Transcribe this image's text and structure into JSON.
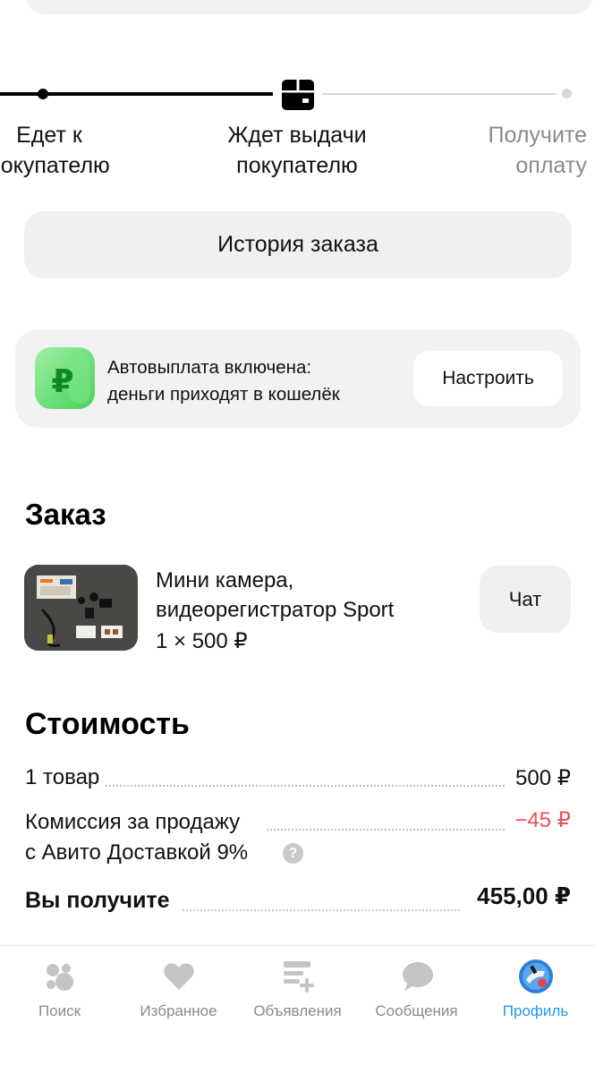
{
  "progress": {
    "steps": [
      {
        "label": "Едет к\nпокупателю",
        "state": "done"
      },
      {
        "label": "Ждет выдачи\nпокупателю",
        "state": "current"
      },
      {
        "label": "Получите\nоплату",
        "state": "todo"
      }
    ],
    "current_icon": "package-icon"
  },
  "history_button": "История заказа",
  "payout": {
    "icon": "ruble-wallet-icon",
    "text": "Автовыплата включена:\nденьги приходят в кошелёк",
    "button": "Настроить"
  },
  "order": {
    "title": "Заказ",
    "item_title": "Мини камера,\nвидеорегистратор Sport",
    "item_price": "1 × 500 ₽",
    "chat_button": "Чат"
  },
  "cost": {
    "title": "Стоимость",
    "rows": [
      {
        "label": "1 товар",
        "value": "500 ₽"
      },
      {
        "label": "Комиссия за продажу\nс Авито Доставкой 9%",
        "value": "−45 ₽"
      },
      {
        "label": "Вы получите",
        "value": "455,00 ₽"
      }
    ],
    "help_icon_label": "?"
  },
  "tabbar": {
    "tabs": [
      {
        "label": "Поиск",
        "icon": "search-dots-icon"
      },
      {
        "label": "Избранное",
        "icon": "heart-icon"
      },
      {
        "label": "Объявления",
        "icon": "listing-add-icon"
      },
      {
        "label": "Сообщения",
        "icon": "chat-bubble-icon"
      },
      {
        "label": "Профиль",
        "icon": "profile-avatar-icon",
        "active": true
      }
    ]
  },
  "colors": {
    "accent": "#1d9bf0",
    "negative": "#e8505b",
    "badge_green": "#48d15a"
  }
}
